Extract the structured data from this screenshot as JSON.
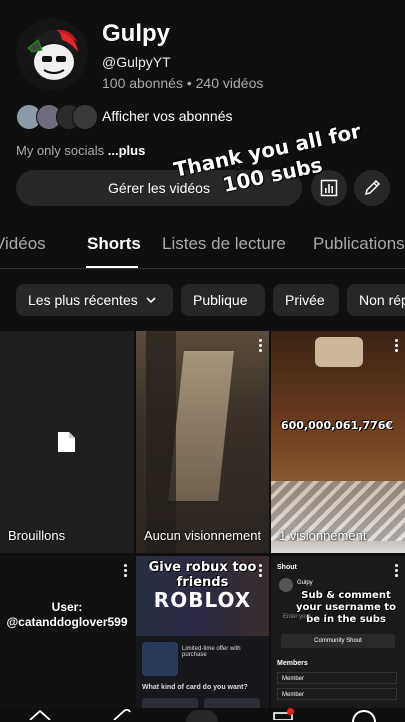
{
  "channel": {
    "name": "Gulpy",
    "handle": "@GulpyYT",
    "stats": "100 abonnés • 240 vidéos",
    "subscribers_link": "Afficher vos abonnés",
    "bio_prefix": "My only socials ",
    "bio_more": "...plus",
    "manage_label": "Gérer les vidéos"
  },
  "overlay": {
    "line1": "Thank you all for",
    "line2": "100 subs"
  },
  "tabs": [
    {
      "label": "Vidéos"
    },
    {
      "label": "Shorts"
    },
    {
      "label": "Listes de lecture"
    },
    {
      "label": "Publications"
    }
  ],
  "chips": [
    {
      "label": "Les plus récentes"
    },
    {
      "label": "Publique"
    },
    {
      "label": "Privée"
    },
    {
      "label": "Non répertoriée"
    }
  ],
  "grid": {
    "drafts_label": "Brouillons",
    "tile2_label": "Aucun visionnement",
    "tile3_label": "1 visionnement",
    "tile3_overlay": "600,000,061,776€",
    "tile4_text_line1": "User:",
    "tile4_text_line2": "@catanddoglover599",
    "tile5_caption_line1": "Give robux too",
    "tile5_caption_line2": "friends",
    "tile5_logo": "ROBLOX",
    "tile5_offer": "Limited-time offer with purchase",
    "tile5_question": "What kind of card do you want?",
    "tile6_header": "Shout",
    "tile6_user": "Gulpy",
    "tile6_caption_line1": "Sub & comment",
    "tile6_caption_line2": "your username to",
    "tile6_caption_line3": "be in the subs",
    "tile6_placeholder": "Enter your",
    "tile6_button": "Community Shout",
    "tile6_members": "Members",
    "tile6_member1": "Member",
    "tile6_member2": "Member"
  }
}
